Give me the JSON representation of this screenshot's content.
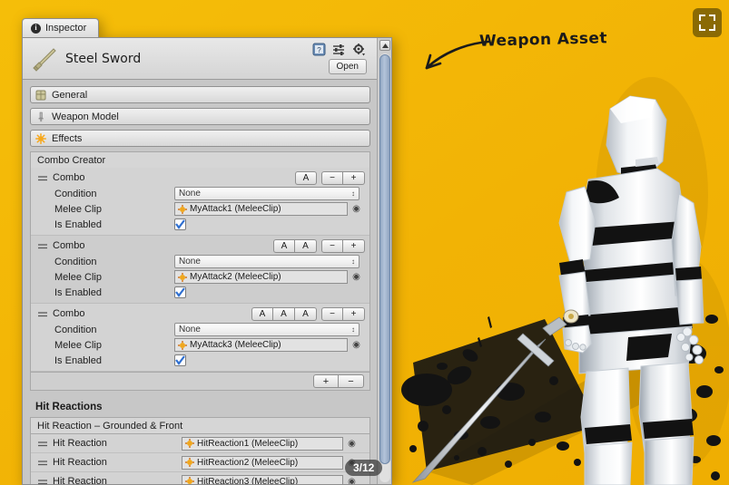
{
  "background": {
    "color": "#F2B705",
    "character": "3d-mannequin-holding-sword",
    "splatter": "ink-splatter"
  },
  "fullscreen_button": {
    "name": "fullscreen-icon"
  },
  "annotation": {
    "text": "Weapon Asset",
    "arrow": "curved-arrow-left-down"
  },
  "window": {
    "tab": {
      "label": "Inspector",
      "icon": "info-icon"
    },
    "asset": {
      "title": "Steel Sword",
      "icon": "sword-icon",
      "open_label": "Open",
      "header_icons": [
        "help-icon",
        "preset-icon",
        "gear-icon"
      ]
    },
    "sections": [
      {
        "label": "General",
        "icon": "package-icon"
      },
      {
        "label": "Weapon Model",
        "icon": "sword-vertical-icon"
      },
      {
        "label": "Effects",
        "icon": "sparkle-icon"
      }
    ],
    "combo_creator": {
      "header": "Combo Creator",
      "combos": [
        {
          "label": "Combo",
          "attack_buttons": [
            "A"
          ],
          "remove_label": "−",
          "add_label": "+",
          "condition_label": "Condition",
          "condition_value": "None",
          "clip_label": "Melee Clip",
          "clip_value": "MyAttack1 (MeleeClip)",
          "enabled_label": "Is Enabled",
          "enabled": true
        },
        {
          "label": "Combo",
          "attack_buttons": [
            "A",
            "A"
          ],
          "remove_label": "−",
          "add_label": "+",
          "condition_label": "Condition",
          "condition_value": "None",
          "clip_label": "Melee Clip",
          "clip_value": "MyAttack2 (MeleeClip)",
          "enabled_label": "Is Enabled",
          "enabled": true
        },
        {
          "label": "Combo",
          "attack_buttons": [
            "A",
            "A",
            "A"
          ],
          "remove_label": "−",
          "add_label": "+",
          "condition_label": "Condition",
          "condition_value": "None",
          "clip_label": "Melee Clip",
          "clip_value": "MyAttack3 (MeleeClip)",
          "enabled_label": "Is Enabled",
          "enabled": true
        }
      ],
      "footer_add": "+",
      "footer_remove": "−"
    },
    "hit_reactions": {
      "title": "Hit Reactions",
      "group_header": "Hit Reaction – Grounded & Front",
      "rows": [
        {
          "label": "Hit Reaction",
          "clip_value": "HitReaction1 (MeleeClip)"
        },
        {
          "label": "Hit Reaction",
          "clip_value": "HitReaction2 (MeleeClip)"
        },
        {
          "label": "Hit Reaction",
          "clip_value": "HitReaction3 (MeleeClip)"
        }
      ]
    },
    "scrollbar": {
      "name": "vertical-scrollbar"
    }
  },
  "page_badge": "3/12"
}
